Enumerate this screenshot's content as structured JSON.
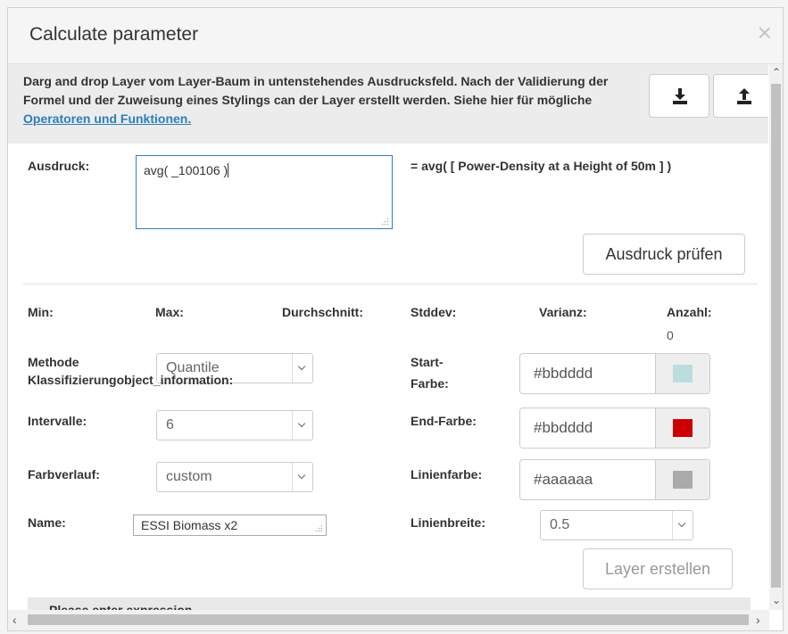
{
  "dialog": {
    "title": "Calculate parameter",
    "close_glyph": "×"
  },
  "info": {
    "text_before": "Darg and drop Layer vom Layer-Baum in untenstehendes Ausdrucksfeld. Nach der Validierung der Formel und der Zuweisung eines Stylings can der Layer erstellt werden. Siehe hier für mögliche ",
    "link_label": "Operatoren und Funktionen."
  },
  "toolbar": {
    "download_icon": "download-icon",
    "upload_icon": "upload-icon"
  },
  "expression": {
    "label": "Ausdruck:",
    "value": "avg( _100106 )",
    "resolved": "= avg( [ Power-Density at a Height of 50m ] )",
    "check_button": "Ausdruck prüfen"
  },
  "stats": {
    "min_label": "Min:",
    "max_label": "Max:",
    "mean_label": "Durchschnitt:",
    "stddev_label": "Stddev:",
    "variance_label": "Varianz:",
    "count_label": "Anzahl:",
    "count_value": "0"
  },
  "style": {
    "method_label_line1": "Methode",
    "method_label_line2": "Klassifizierungobject_information:",
    "method_value": "Quantile",
    "intervals_label": "Intervalle:",
    "intervals_value": "6",
    "gradient_label": "Farbverlauf:",
    "gradient_value": "custom",
    "name_label": "Name:",
    "name_value": "ESSI Biomass x2",
    "start_color_label_line1": "Start-",
    "start_color_label_line2": "Farbe:",
    "start_color_value": "#bbdddd",
    "start_swatch": "#bbdddd",
    "end_color_label": "End-Farbe:",
    "end_color_value": "#bbdddd",
    "end_swatch": "#cc0000",
    "line_color_label": "Linienfarbe:",
    "line_color_value": "#aaaaaa",
    "line_swatch": "#aaaaaa",
    "line_width_label": "Linienbreite:",
    "line_width_value": "0.5",
    "create_button": "Layer erstellen"
  },
  "status": {
    "message": "Please enter expression"
  }
}
